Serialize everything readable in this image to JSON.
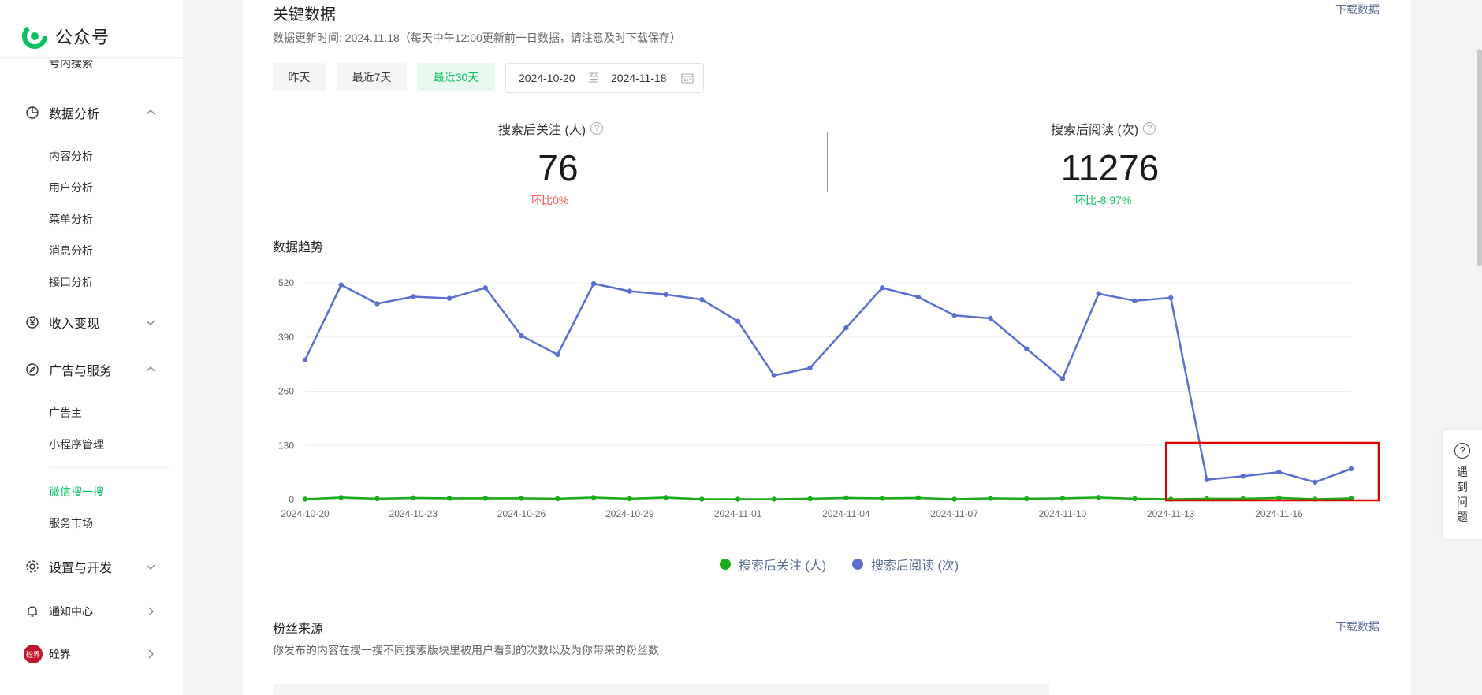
{
  "app": {
    "name": "公众号"
  },
  "sidebar": {
    "cut_item": "号内搜索",
    "groups": {
      "data_analysis": {
        "label": "数据分析",
        "items": [
          "内容分析",
          "用户分析",
          "菜单分析",
          "消息分析",
          "接口分析"
        ]
      },
      "monetize": {
        "label": "收入变现"
      },
      "ads": {
        "label": "广告与服务",
        "items": [
          "广告主",
          "小程序管理",
          "微信搜一搜",
          "服务市场"
        ],
        "active": "微信搜一搜"
      },
      "settings": {
        "label": "设置与开发"
      },
      "notify": {
        "label": "通知中心"
      },
      "account": {
        "label": "砼界",
        "avatar_text": "砼界"
      }
    }
  },
  "key_data": {
    "title": "关键数据",
    "update_note": "数据更新时间: 2024.11.18（每天中午12:00更新前一日数据，请注意及时下载保存）",
    "download": "下载数据",
    "ranges": [
      "昨天",
      "最近7天",
      "最近30天"
    ],
    "active_range": "最近30天",
    "date_from": "2024-10-20",
    "date_sep": "至",
    "date_to": "2024-11-18",
    "kpis": [
      {
        "label": "搜索后关注 (人)",
        "value": "76",
        "change": "环比0%",
        "change_color": "#fa5151"
      },
      {
        "label": "搜索后阅读 (次)",
        "value": "11276",
        "change": "环比-8.97%",
        "change_color": "#07c160"
      }
    ]
  },
  "trend": {
    "title": "数据趋势"
  },
  "chart_data": {
    "type": "line",
    "x": [
      "2024-10-20",
      "2024-10-21",
      "2024-10-22",
      "2024-10-23",
      "2024-10-24",
      "2024-10-25",
      "2024-10-26",
      "2024-10-27",
      "2024-10-28",
      "2024-10-29",
      "2024-10-30",
      "2024-10-31",
      "2024-11-01",
      "2024-11-02",
      "2024-11-03",
      "2024-11-04",
      "2024-11-05",
      "2024-11-06",
      "2024-11-07",
      "2024-11-08",
      "2024-11-09",
      "2024-11-10",
      "2024-11-11",
      "2024-11-12",
      "2024-11-13",
      "2024-11-14",
      "2024-11-15",
      "2024-11-16",
      "2024-11-17",
      "2024-11-18"
    ],
    "x_tick_labels": [
      "2024-10-20",
      "2024-10-23",
      "2024-10-26",
      "2024-10-29",
      "2024-11-01",
      "2024-11-04",
      "2024-11-07",
      "2024-11-10",
      "2024-11-13",
      "2024-11-16"
    ],
    "y_ticks": [
      0,
      130,
      260,
      390,
      520
    ],
    "ylim": [
      0,
      520
    ],
    "series": [
      {
        "name": "搜索后关注 (人)",
        "color": "#1aad19",
        "values": [
          1,
          5,
          2,
          4,
          3,
          3,
          3,
          2,
          5,
          2,
          5,
          1,
          1,
          1,
          2,
          4,
          3,
          4,
          1,
          3,
          2,
          3,
          5,
          2,
          1,
          2,
          2,
          4,
          1,
          3
        ]
      },
      {
        "name": "搜索后阅读 (次)",
        "color": "#5b6fcf",
        "values": [
          335,
          515,
          470,
          487,
          483,
          508,
          393,
          348,
          518,
          500,
          492,
          480,
          428,
          298,
          316,
          412,
          508,
          486,
          442,
          435,
          362,
          290,
          494,
          477,
          484,
          48,
          56,
          66,
          42,
          74
        ]
      }
    ],
    "annotation": {
      "type": "highlight-box",
      "color": "#e00000",
      "from": "2024-11-13",
      "to": "2024-11-18"
    },
    "grid": true,
    "legend_position": "bottom"
  },
  "fans_source": {
    "title": "粉丝来源",
    "desc": "你发布的内容在搜一搜不同搜索版块里被用户看到的次数以及为你带来的粉丝数",
    "download": "下载数据"
  },
  "help_widget": {
    "icon": "question-icon",
    "text": "遇到问题"
  }
}
